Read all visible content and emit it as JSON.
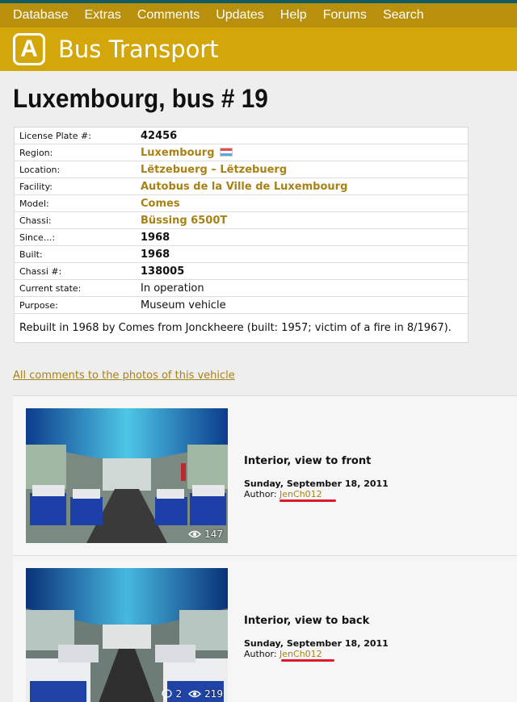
{
  "nav": {
    "items": [
      "Database",
      "Extras",
      "Comments",
      "Updates",
      "Help",
      "Forums",
      "Search"
    ]
  },
  "brand": {
    "logo_letter": "A",
    "title": "Bus Transport"
  },
  "page": {
    "title": "Luxembourg, bus # 19"
  },
  "info": {
    "rows": [
      {
        "label": "License Plate #:",
        "value": "42456"
      },
      {
        "label": "Region:",
        "value": "Luxembourg"
      },
      {
        "label": "Location:",
        "value": "Lëtzebuerg – Lëtzebuerg"
      },
      {
        "label": "Facility:",
        "value": "Autobus de la Ville de Luxembourg"
      },
      {
        "label": "Model:",
        "value": "Comes"
      },
      {
        "label": "Chassi:",
        "value": "Büssing 6500T"
      },
      {
        "label": "Since...:",
        "value": "1968"
      },
      {
        "label": "Built:",
        "value": "1968"
      },
      {
        "label": "Chassi #:",
        "value": "138005"
      },
      {
        "label": "Current state:",
        "value": "In operation"
      },
      {
        "label": "Purpose:",
        "value": "Museum vehicle"
      }
    ],
    "note": "Rebuilt in 1968 by Comes from Jonckheere (built: 1957; victim of a fire in 8/1967)."
  },
  "comments_link": "All comments to the photos of this vehicle",
  "photos": [
    {
      "title": "Interior, view to front",
      "date": "Sunday, September 18, 2011",
      "author_label": "Author:",
      "author": "JenCh012",
      "views": "147",
      "comments": ""
    },
    {
      "title": "Interior, view to back",
      "date": "Sunday, September 18, 2011",
      "author_label": "Author:",
      "author": "JenCh012",
      "views": "219",
      "comments": "2"
    }
  ],
  "colors": {
    "nav_bg": "#b8900c",
    "brand_bg": "#d3a70a",
    "link": "#a88214",
    "highlight_underline": "#e0192a"
  },
  "icons": {
    "views": "eye-icon",
    "comments": "speech-bubble-icon",
    "flag": "luxembourg-flag-icon"
  }
}
